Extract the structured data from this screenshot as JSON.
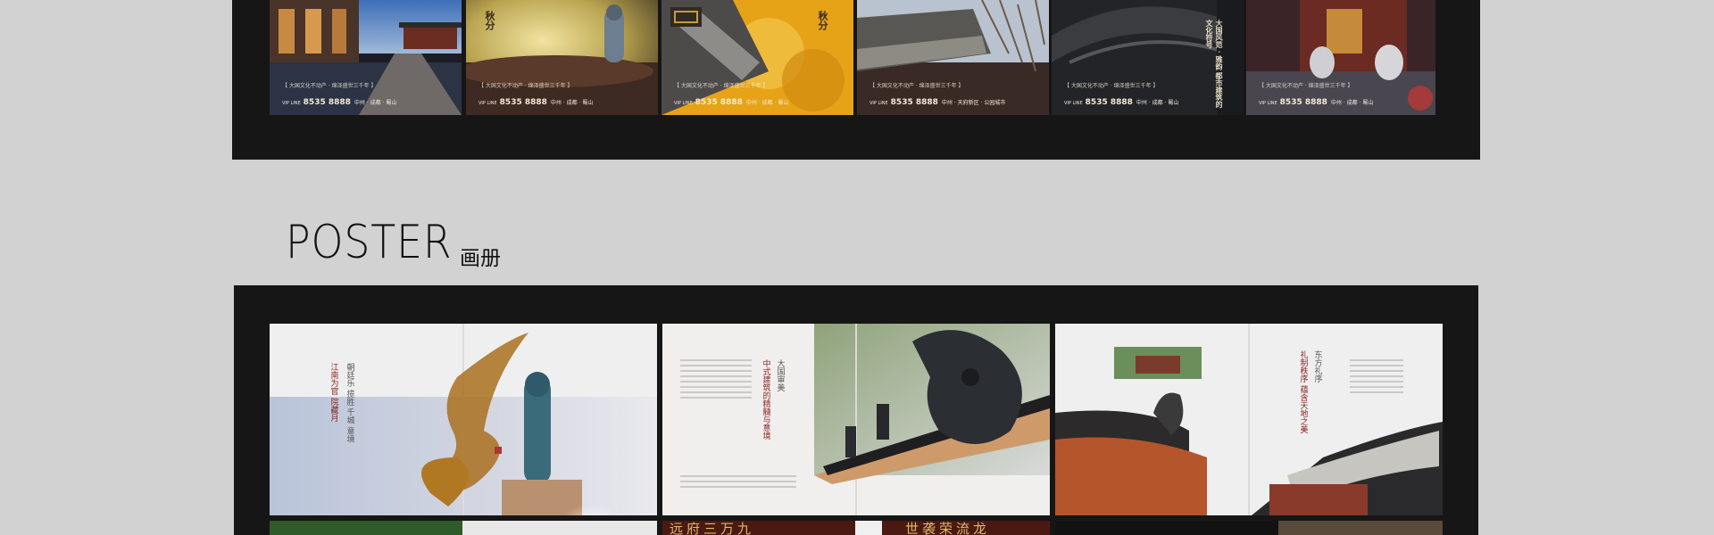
{
  "top_gallery": {
    "items": [
      {
        "line1": "【 大国文化不动产 · 绵泽盛世三千年 】",
        "hotline_prefix": "VIP LINE",
        "hotline": "8535 8888",
        "suffix": "中州 · 成都 · 蜀山",
        "vertical": ""
      },
      {
        "line1": "【 大国文化不动产 · 绵泽盛世三千年 】",
        "hotline_prefix": "VIP LINE",
        "hotline": "8535 8888",
        "suffix": "中州 · 成都 · 蜀山",
        "vertical": "秋分"
      },
      {
        "line1": "【 大国文化不动产 · 绵泽盛世三千年 】",
        "hotline_prefix": "VIP LINE",
        "hotline": "8535 8888",
        "suffix": "中州 · 成都 · 蜀山",
        "vertical": "秋分"
      },
      {
        "line1": "【 大国文化不动产 · 绵泽盛世三千年 】",
        "hotline_prefix": "VIP LINE",
        "hotline": "8535 8888",
        "suffix": "中州 · 天府新区 · 公园城市",
        "vertical": ""
      },
      {
        "line1": "【 大国文化不动产 · 绵泽盛世三千年 】",
        "hotline_prefix": "VIP LINE",
        "hotline": "8535 8888",
        "suffix": "中州 · 成都 · 蜀山",
        "vertical": "大国风范 · 雅韵 都市建筑的文化符号"
      },
      {
        "line1": "【 大国文化不动产 · 绵泽盛世三千年 】",
        "hotline_prefix": "VIP LINE",
        "hotline": "8535 8888",
        "suffix": "中州 · 成都 · 蜀山",
        "vertical": ""
      }
    ]
  },
  "section": {
    "title": "POSTER",
    "subtitle": "画册"
  },
  "spreads": {
    "row1": [
      {
        "vertical_text": "江南为官 院藏月",
        "vertical_text2": "朝廷乐 揽胜 千城 意境"
      },
      {
        "vertical_text": "中式建筑的精髓与意境",
        "vertical_text2": "大国审美"
      },
      {
        "vertical_text": "礼制秩序 蕴含天地之美",
        "vertical_text2": "东方礼序"
      }
    ],
    "row2_headlines": [
      "远府三万九",
      "世袭荣流龙"
    ]
  },
  "colors": {
    "background": "#d2d2d2",
    "panel": "#161616",
    "accent_red": "#b23232",
    "gold": "#e0a21a"
  }
}
